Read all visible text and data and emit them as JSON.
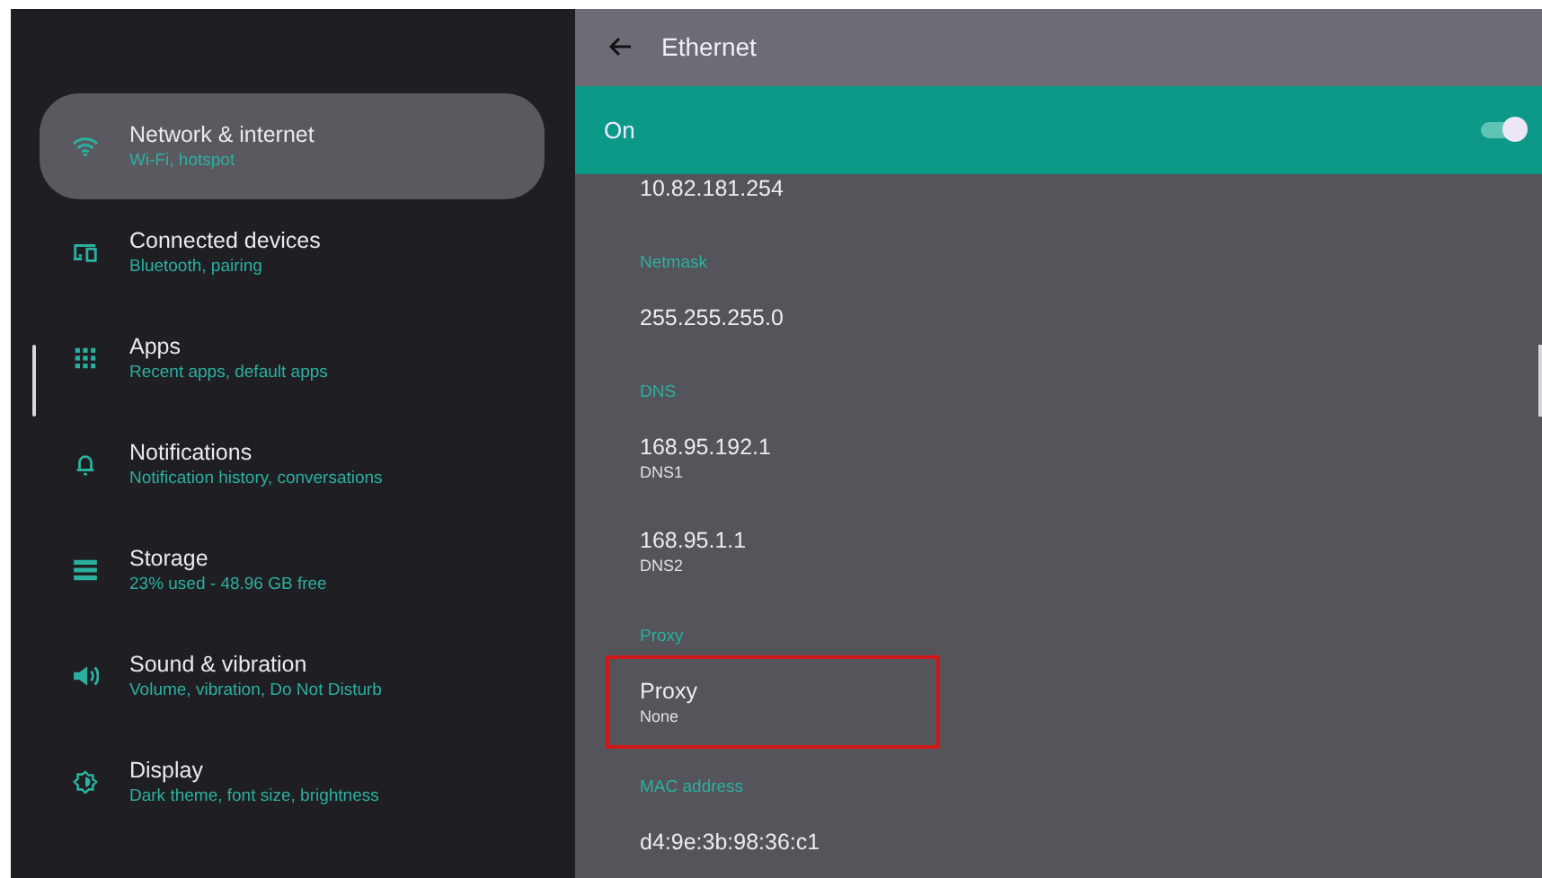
{
  "sidebar": {
    "items": [
      {
        "title": "Network & internet",
        "summary": "Wi-Fi, hotspot",
        "selected": true
      },
      {
        "title": "Connected devices",
        "summary": "Bluetooth, pairing",
        "selected": false
      },
      {
        "title": "Apps",
        "summary": "Recent apps, default apps",
        "selected": false
      },
      {
        "title": "Notifications",
        "summary": "Notification history, conversations",
        "selected": false
      },
      {
        "title": "Storage",
        "summary": "23% used - 48.96 GB free",
        "selected": false
      },
      {
        "title": "Sound & vibration",
        "summary": "Volume, vibration, Do Not Disturb",
        "selected": false
      },
      {
        "title": "Display",
        "summary": "Dark theme, font size, brightness",
        "selected": false
      }
    ]
  },
  "header": {
    "title": "Ethernet"
  },
  "main_switch": {
    "label": "On",
    "on": true
  },
  "rows": [
    {
      "kind": "value",
      "title": "10.82.181.254"
    },
    {
      "kind": "header",
      "title": "Netmask"
    },
    {
      "kind": "value",
      "title": "255.255.255.0"
    },
    {
      "kind": "header",
      "title": "DNS"
    },
    {
      "kind": "item",
      "title": "168.95.192.1",
      "summary": "DNS1",
      "highlighted": false
    },
    {
      "kind": "item",
      "title": "168.95.1.1",
      "summary": "DNS2",
      "highlighted": false
    },
    {
      "kind": "header",
      "title": "Proxy"
    },
    {
      "kind": "item",
      "title": "Proxy",
      "summary": "None",
      "highlighted": true
    },
    {
      "kind": "header",
      "title": "MAC address"
    },
    {
      "kind": "value",
      "title": "d4:9e:3b:98:36:c1"
    }
  ]
}
